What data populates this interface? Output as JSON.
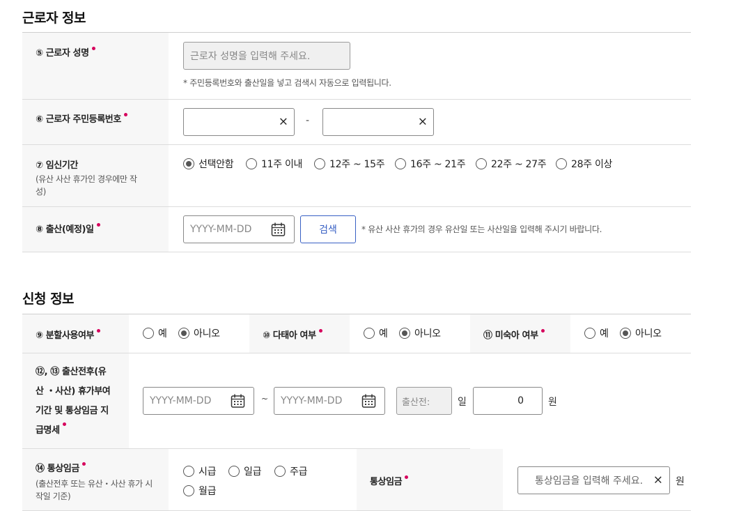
{
  "worker_section": {
    "title": "근로자 정보",
    "name_field": {
      "label": "⑤ 근로자 성명",
      "placeholder": "근로자 성명을 입력해 주세요.",
      "note": "* 주민등록번호와 출산일을 넣고 검색시 자동으로 입력됩니다."
    },
    "rrn_field": {
      "label": "⑥ 근로자 주민등록번호",
      "separator": "-",
      "clear_icon": "×"
    },
    "pregnancy_period": {
      "label": "⑦ 임신기간",
      "sublabel_line1": "(유산 사산 휴가인 경우에만 작",
      "sublabel_line2": "성)",
      "options": [
        "선택안함",
        "11주 이내",
        "12주 ~ 15주",
        "16주 ~ 21주",
        "22주 ~ 27주",
        "28주 이상"
      ],
      "selected": "선택안함"
    },
    "due_date": {
      "label": "⑧ 출산(예정)일",
      "placeholder": "YYYY-MM-DD",
      "search_button": "검색",
      "note": "* 유산 사산 휴가의 경우 유산일 또는 사산일을 입력해 주시기 바랍니다."
    }
  },
  "application_section": {
    "title": "신청 정보",
    "split_use": {
      "label": "⑨ 분할사용여부",
      "options": [
        "예",
        "아니오"
      ],
      "selected": "아니오"
    },
    "multiple_birth": {
      "label": "⑩ 다태아 여부",
      "options": [
        "예",
        "아니오"
      ],
      "selected": "아니오"
    },
    "premature": {
      "label": "⑪ 미숙아 여부",
      "options": [
        "예",
        "아니오"
      ],
      "selected": "아니오"
    },
    "leave_period": {
      "label_line1": "⑫, ⑬ 출산전후(유",
      "label_line2": "산 ・사산) 휴가부여",
      "label_line3": "기간 및 통상임금 지",
      "label_line4": "급명세",
      "start_placeholder": "YYYY-MM-DD",
      "tilde": "~",
      "end_placeholder": "YYYY-MM-DD",
      "before_birth_placeholder": "출산전:",
      "day_unit": "일",
      "amount_value": "0",
      "won_unit": "원"
    },
    "ordinary_wage": {
      "label": "⑭ 통상임금",
      "sublabel_line1": "(출산전후 또는 유산・사산 휴가 시",
      "sublabel_line2": "작일 기준)",
      "wage_types": [
        "시급",
        "일급",
        "주급",
        "월급"
      ],
      "right_label": "통상임금",
      "placeholder": "통상임금을 입력해 주세요.",
      "won_unit": "원"
    }
  },
  "icons": {
    "calendar": "calendar-icon",
    "clear": "close-icon"
  }
}
